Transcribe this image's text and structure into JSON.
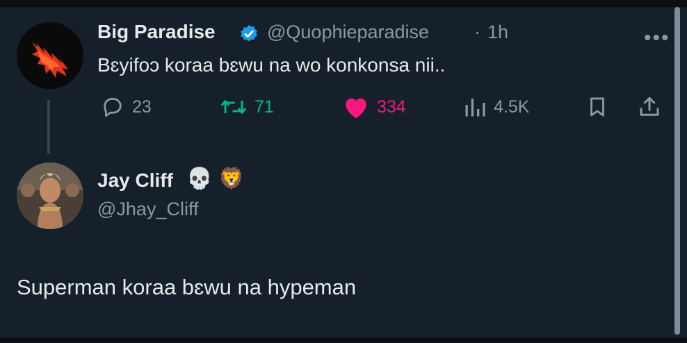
{
  "colors": {
    "background": "#15202b",
    "text": "#e7e9ea",
    "secondary": "#8b98a5",
    "verified": "#1d9bf0",
    "retweet": "#00ba7c",
    "like": "#f91880"
  },
  "tweet": {
    "author_name": "Big Paradise",
    "verified_icon": "verified-badge-icon",
    "handle": "@Quophieparadise",
    "separator": "·",
    "time": "1h",
    "text": "Bɛyifoɔ koraa bɛwu na wo konkonsa nii..",
    "more_icon": "more-options-icon",
    "more_label": "•••",
    "stats": {
      "replies": "23",
      "retweets": "71",
      "likes": "334",
      "views": "4.5K"
    }
  },
  "reply": {
    "author_name": "Jay Cliff",
    "emoji1": "💀",
    "emoji2": "🦁",
    "handle": "@Jhay_Cliff",
    "text": "Superman koraa bɛwu na hypeman"
  }
}
